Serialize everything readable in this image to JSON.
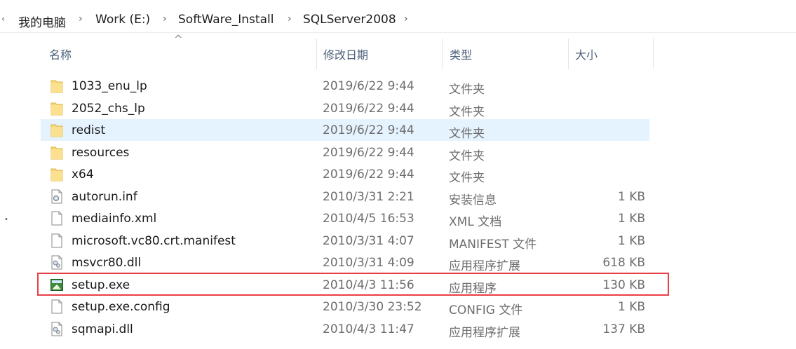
{
  "breadcrumb": {
    "items": [
      "我的电脑",
      "Work (E:)",
      "SoftWare_Install",
      "SQLServer2008"
    ],
    "separator": "›"
  },
  "columns": {
    "name": "名称",
    "modified": "修改日期",
    "type": "类型",
    "size": "大小"
  },
  "files": [
    {
      "name": "1033_enu_lp",
      "modified": "2019/6/22 9:44",
      "type": "文件夹",
      "size": "",
      "icon": "folder-icon"
    },
    {
      "name": "2052_chs_lp",
      "modified": "2019/6/22 9:44",
      "type": "文件夹",
      "size": "",
      "icon": "folder-icon"
    },
    {
      "name": "redist",
      "modified": "2019/6/22 9:44",
      "type": "文件夹",
      "size": "",
      "icon": "folder-icon"
    },
    {
      "name": "resources",
      "modified": "2019/6/22 9:44",
      "type": "文件夹",
      "size": "",
      "icon": "folder-icon"
    },
    {
      "name": "x64",
      "modified": "2019/6/22 9:44",
      "type": "文件夹",
      "size": "",
      "icon": "folder-icon"
    },
    {
      "name": "autorun.inf",
      "modified": "2010/3/31 2:21",
      "type": "安装信息",
      "size": "1 KB",
      "icon": "settings-file-icon"
    },
    {
      "name": "mediainfo.xml",
      "modified": "2010/4/5 16:53",
      "type": "XML 文档",
      "size": "1 KB",
      "icon": "file-icon"
    },
    {
      "name": "microsoft.vc80.crt.manifest",
      "modified": "2010/3/31 4:07",
      "type": "MANIFEST 文件",
      "size": "1 KB",
      "icon": "file-icon"
    },
    {
      "name": "msvcr80.dll",
      "modified": "2010/3/31 4:09",
      "type": "应用程序扩展",
      "size": "618 KB",
      "icon": "dll-file-icon"
    },
    {
      "name": "setup.exe",
      "modified": "2010/4/3 11:56",
      "type": "应用程序",
      "size": "130 KB",
      "icon": "exe-file-icon"
    },
    {
      "name": "setup.exe.config",
      "modified": "2010/3/30 23:52",
      "type": "CONFIG 文件",
      "size": "1 KB",
      "icon": "file-icon"
    },
    {
      "name": "sqmapi.dll",
      "modified": "2010/4/3 11:47",
      "type": "应用程序扩展",
      "size": "137 KB",
      "icon": "dll-file-icon"
    }
  ],
  "selected_index": 2,
  "highlighted_index": 9,
  "colors": {
    "folder": "#f8d775",
    "selection": "#e5f3ff",
    "highlight_border": "#e83f46",
    "header_text": "#4c607a"
  }
}
